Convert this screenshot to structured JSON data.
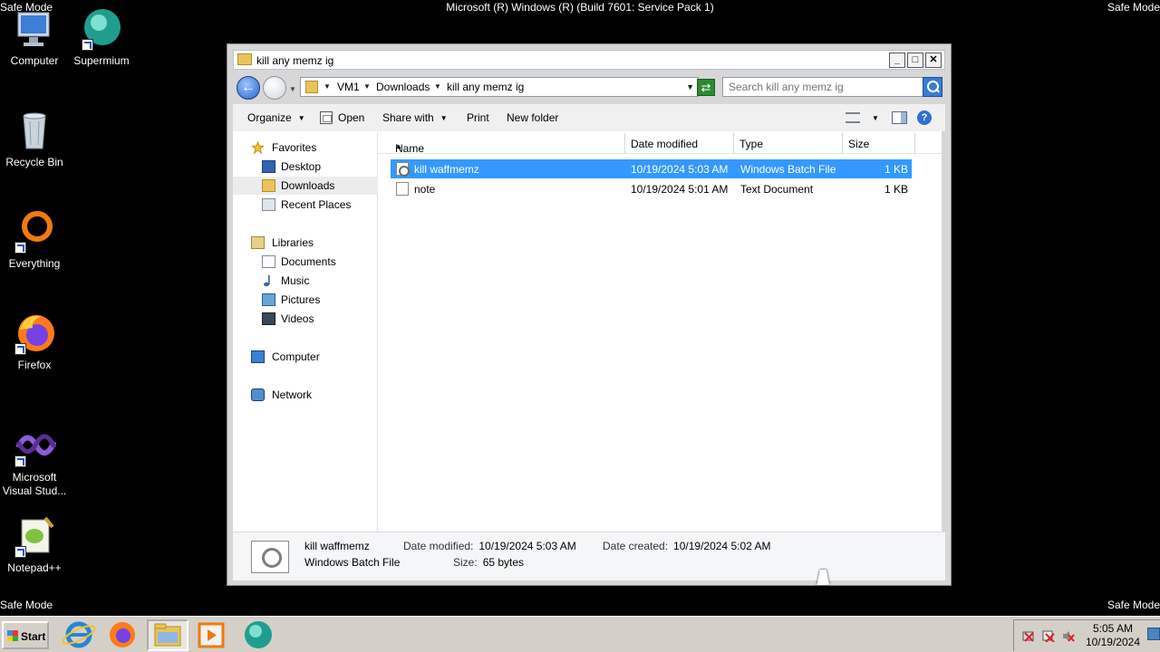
{
  "desktop": {
    "safe_mode_label": "Safe Mode",
    "build_text": "Microsoft (R) Windows (R) (Build 7601: Service Pack 1)",
    "icons": [
      {
        "label": "Computer"
      },
      {
        "label": "Supermium"
      },
      {
        "label": "Recycle Bin"
      },
      {
        "label": "Everything"
      },
      {
        "label": "Firefox"
      },
      {
        "label": "Microsoft Visual Stud..."
      },
      {
        "label": "Notepad++"
      }
    ]
  },
  "window": {
    "title": "kill any memz ig",
    "controls": {
      "minimize": "_",
      "maximize": "□",
      "close": "✕"
    },
    "address": {
      "segments": [
        "VM1",
        "Downloads",
        "kill any memz ig"
      ]
    },
    "search": {
      "placeholder": "Search kill any memz ig"
    },
    "toolbar": {
      "organize": "Organize",
      "open": "Open",
      "share_with": "Share with",
      "print": "Print",
      "new_folder": "New folder",
      "help": "?"
    },
    "nav": {
      "favorites": "Favorites",
      "desktop": "Desktop",
      "downloads": "Downloads",
      "recent_places": "Recent Places",
      "libraries": "Libraries",
      "documents": "Documents",
      "music": "Music",
      "pictures": "Pictures",
      "videos": "Videos",
      "computer": "Computer",
      "network": "Network"
    },
    "columns": {
      "name": "Name",
      "date_modified": "Date modified",
      "type": "Type",
      "size": "Size"
    },
    "files": [
      {
        "name": "kill waffmemz",
        "date": "10/19/2024 5:03 AM",
        "type": "Windows Batch File",
        "size": "1 KB",
        "selected": true
      },
      {
        "name": "note",
        "date": "10/19/2024 5:01 AM",
        "type": "Text Document",
        "size": "1 KB",
        "selected": false
      }
    ],
    "details": {
      "name": "kill waffmemz",
      "type": "Windows Batch File",
      "date_modified_label": "Date modified:",
      "date_modified": "10/19/2024 5:03 AM",
      "date_created_label": "Date created:",
      "date_created": "10/19/2024 5:02 AM",
      "size_label": "Size:",
      "size": "65 bytes"
    }
  },
  "taskbar": {
    "start": "Start",
    "clock_time": "5:05 AM",
    "clock_date": "10/19/2024"
  },
  "colors": {
    "selection": "#3399ff",
    "desktop_bg": "#000000",
    "taskbar_bg": "#d4d0c8"
  }
}
